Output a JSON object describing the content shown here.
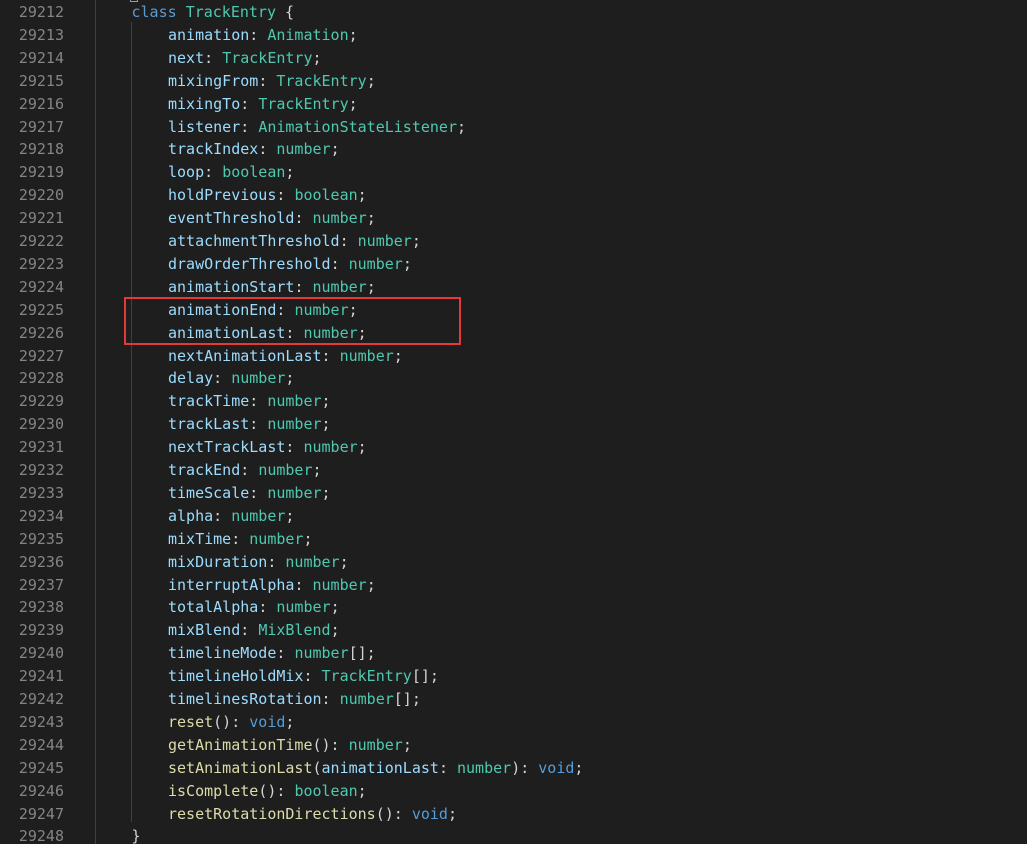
{
  "editor": {
    "line_numbers": [
      "29212",
      "29213",
      "29214",
      "29215",
      "29216",
      "29217",
      "29218",
      "29219",
      "29220",
      "29221",
      "29222",
      "29223",
      "29224",
      "29225",
      "29226",
      "29227",
      "29228",
      "29229",
      "29230",
      "29231",
      "29232",
      "29233",
      "29234",
      "29235",
      "29236",
      "29237",
      "29238",
      "29239",
      "29240",
      "29241",
      "29242",
      "29243",
      "29244",
      "29245",
      "29246",
      "29247",
      "29248"
    ],
    "lines": [
      {
        "indent": 1,
        "tokens": [
          [
            "kw",
            "class"
          ],
          [
            "punc",
            " "
          ],
          [
            "type",
            "TrackEntry"
          ],
          [
            "punc",
            " {"
          ]
        ]
      },
      {
        "indent": 2,
        "tokens": [
          [
            "prop",
            "animation"
          ],
          [
            "punc",
            ": "
          ],
          [
            "type",
            "Animation"
          ],
          [
            "punc",
            ";"
          ]
        ]
      },
      {
        "indent": 2,
        "tokens": [
          [
            "prop",
            "next"
          ],
          [
            "punc",
            ": "
          ],
          [
            "type",
            "TrackEntry"
          ],
          [
            "punc",
            ";"
          ]
        ]
      },
      {
        "indent": 2,
        "tokens": [
          [
            "prop",
            "mixingFrom"
          ],
          [
            "punc",
            ": "
          ],
          [
            "type",
            "TrackEntry"
          ],
          [
            "punc",
            ";"
          ]
        ]
      },
      {
        "indent": 2,
        "tokens": [
          [
            "prop",
            "mixingTo"
          ],
          [
            "punc",
            ": "
          ],
          [
            "type",
            "TrackEntry"
          ],
          [
            "punc",
            ";"
          ]
        ]
      },
      {
        "indent": 2,
        "tokens": [
          [
            "prop",
            "listener"
          ],
          [
            "punc",
            ": "
          ],
          [
            "type",
            "AnimationStateListener"
          ],
          [
            "punc",
            ";"
          ]
        ]
      },
      {
        "indent": 2,
        "tokens": [
          [
            "prop",
            "trackIndex"
          ],
          [
            "punc",
            ": "
          ],
          [
            "type",
            "number"
          ],
          [
            "punc",
            ";"
          ]
        ]
      },
      {
        "indent": 2,
        "tokens": [
          [
            "prop",
            "loop"
          ],
          [
            "punc",
            ": "
          ],
          [
            "type",
            "boolean"
          ],
          [
            "punc",
            ";"
          ]
        ]
      },
      {
        "indent": 2,
        "tokens": [
          [
            "prop",
            "holdPrevious"
          ],
          [
            "punc",
            ": "
          ],
          [
            "type",
            "boolean"
          ],
          [
            "punc",
            ";"
          ]
        ]
      },
      {
        "indent": 2,
        "tokens": [
          [
            "prop",
            "eventThreshold"
          ],
          [
            "punc",
            ": "
          ],
          [
            "type",
            "number"
          ],
          [
            "punc",
            ";"
          ]
        ]
      },
      {
        "indent": 2,
        "tokens": [
          [
            "prop",
            "attachmentThreshold"
          ],
          [
            "punc",
            ": "
          ],
          [
            "type",
            "number"
          ],
          [
            "punc",
            ";"
          ]
        ]
      },
      {
        "indent": 2,
        "tokens": [
          [
            "prop",
            "drawOrderThreshold"
          ],
          [
            "punc",
            ": "
          ],
          [
            "type",
            "number"
          ],
          [
            "punc",
            ";"
          ]
        ]
      },
      {
        "indent": 2,
        "tokens": [
          [
            "prop",
            "animationStart"
          ],
          [
            "punc",
            ": "
          ],
          [
            "type",
            "number"
          ],
          [
            "punc",
            ";"
          ]
        ]
      },
      {
        "indent": 2,
        "tokens": [
          [
            "prop",
            "animationEnd"
          ],
          [
            "punc",
            ": "
          ],
          [
            "type",
            "number"
          ],
          [
            "punc",
            ";"
          ]
        ]
      },
      {
        "indent": 2,
        "tokens": [
          [
            "prop",
            "animationLast"
          ],
          [
            "punc",
            ": "
          ],
          [
            "type",
            "number"
          ],
          [
            "punc",
            ";"
          ]
        ]
      },
      {
        "indent": 2,
        "tokens": [
          [
            "prop",
            "nextAnimationLast"
          ],
          [
            "punc",
            ": "
          ],
          [
            "type",
            "number"
          ],
          [
            "punc",
            ";"
          ]
        ]
      },
      {
        "indent": 2,
        "tokens": [
          [
            "prop",
            "delay"
          ],
          [
            "punc",
            ": "
          ],
          [
            "type",
            "number"
          ],
          [
            "punc",
            ";"
          ]
        ]
      },
      {
        "indent": 2,
        "tokens": [
          [
            "prop",
            "trackTime"
          ],
          [
            "punc",
            ": "
          ],
          [
            "type",
            "number"
          ],
          [
            "punc",
            ";"
          ]
        ]
      },
      {
        "indent": 2,
        "tokens": [
          [
            "prop",
            "trackLast"
          ],
          [
            "punc",
            ": "
          ],
          [
            "type",
            "number"
          ],
          [
            "punc",
            ";"
          ]
        ]
      },
      {
        "indent": 2,
        "tokens": [
          [
            "prop",
            "nextTrackLast"
          ],
          [
            "punc",
            ": "
          ],
          [
            "type",
            "number"
          ],
          [
            "punc",
            ";"
          ]
        ]
      },
      {
        "indent": 2,
        "tokens": [
          [
            "prop",
            "trackEnd"
          ],
          [
            "punc",
            ": "
          ],
          [
            "type",
            "number"
          ],
          [
            "punc",
            ";"
          ]
        ]
      },
      {
        "indent": 2,
        "tokens": [
          [
            "prop",
            "timeScale"
          ],
          [
            "punc",
            ": "
          ],
          [
            "type",
            "number"
          ],
          [
            "punc",
            ";"
          ]
        ]
      },
      {
        "indent": 2,
        "tokens": [
          [
            "prop",
            "alpha"
          ],
          [
            "punc",
            ": "
          ],
          [
            "type",
            "number"
          ],
          [
            "punc",
            ";"
          ]
        ]
      },
      {
        "indent": 2,
        "tokens": [
          [
            "prop",
            "mixTime"
          ],
          [
            "punc",
            ": "
          ],
          [
            "type",
            "number"
          ],
          [
            "punc",
            ";"
          ]
        ]
      },
      {
        "indent": 2,
        "tokens": [
          [
            "prop",
            "mixDuration"
          ],
          [
            "punc",
            ": "
          ],
          [
            "type",
            "number"
          ],
          [
            "punc",
            ";"
          ]
        ]
      },
      {
        "indent": 2,
        "tokens": [
          [
            "prop",
            "interruptAlpha"
          ],
          [
            "punc",
            ": "
          ],
          [
            "type",
            "number"
          ],
          [
            "punc",
            ";"
          ]
        ]
      },
      {
        "indent": 2,
        "tokens": [
          [
            "prop",
            "totalAlpha"
          ],
          [
            "punc",
            ": "
          ],
          [
            "type",
            "number"
          ],
          [
            "punc",
            ";"
          ]
        ]
      },
      {
        "indent": 2,
        "tokens": [
          [
            "prop",
            "mixBlend"
          ],
          [
            "punc",
            ": "
          ],
          [
            "type",
            "MixBlend"
          ],
          [
            "punc",
            ";"
          ]
        ]
      },
      {
        "indent": 2,
        "tokens": [
          [
            "prop",
            "timelineMode"
          ],
          [
            "punc",
            ": "
          ],
          [
            "type",
            "number"
          ],
          [
            "punc",
            "[];"
          ]
        ]
      },
      {
        "indent": 2,
        "tokens": [
          [
            "prop",
            "timelineHoldMix"
          ],
          [
            "punc",
            ": "
          ],
          [
            "type",
            "TrackEntry"
          ],
          [
            "punc",
            "[];"
          ]
        ]
      },
      {
        "indent": 2,
        "tokens": [
          [
            "prop",
            "timelinesRotation"
          ],
          [
            "punc",
            ": "
          ],
          [
            "type",
            "number"
          ],
          [
            "punc",
            "[];"
          ]
        ]
      },
      {
        "indent": 2,
        "tokens": [
          [
            "fn",
            "reset"
          ],
          [
            "punc",
            "(): "
          ],
          [
            "kw",
            "void"
          ],
          [
            "punc",
            ";"
          ]
        ]
      },
      {
        "indent": 2,
        "tokens": [
          [
            "fn",
            "getAnimationTime"
          ],
          [
            "punc",
            "(): "
          ],
          [
            "type",
            "number"
          ],
          [
            "punc",
            ";"
          ]
        ]
      },
      {
        "indent": 2,
        "tokens": [
          [
            "fn",
            "setAnimationLast"
          ],
          [
            "punc",
            "("
          ],
          [
            "prop",
            "animationLast"
          ],
          [
            "punc",
            ": "
          ],
          [
            "type",
            "number"
          ],
          [
            "punc",
            "): "
          ],
          [
            "kw",
            "void"
          ],
          [
            "punc",
            ";"
          ]
        ]
      },
      {
        "indent": 2,
        "tokens": [
          [
            "fn",
            "isComplete"
          ],
          [
            "punc",
            "(): "
          ],
          [
            "type",
            "boolean"
          ],
          [
            "punc",
            ";"
          ]
        ]
      },
      {
        "indent": 2,
        "tokens": [
          [
            "fn",
            "resetRotationDirections"
          ],
          [
            "punc",
            "(): "
          ],
          [
            "kw",
            "void"
          ],
          [
            "punc",
            ";"
          ]
        ]
      },
      {
        "indent": 1,
        "tokens": [
          [
            "punc",
            "}"
          ]
        ]
      }
    ],
    "highlighted_lines": [
      "29225",
      "29226"
    ],
    "colors": {
      "background": "#1e1e1e",
      "line_number": "#858585",
      "keyword": "#569cd6",
      "type": "#4ec9b0",
      "property": "#9cdcfe",
      "function": "#dcdcaa",
      "punctuation": "#d4d4d4",
      "highlight_box": "#e53935"
    }
  }
}
